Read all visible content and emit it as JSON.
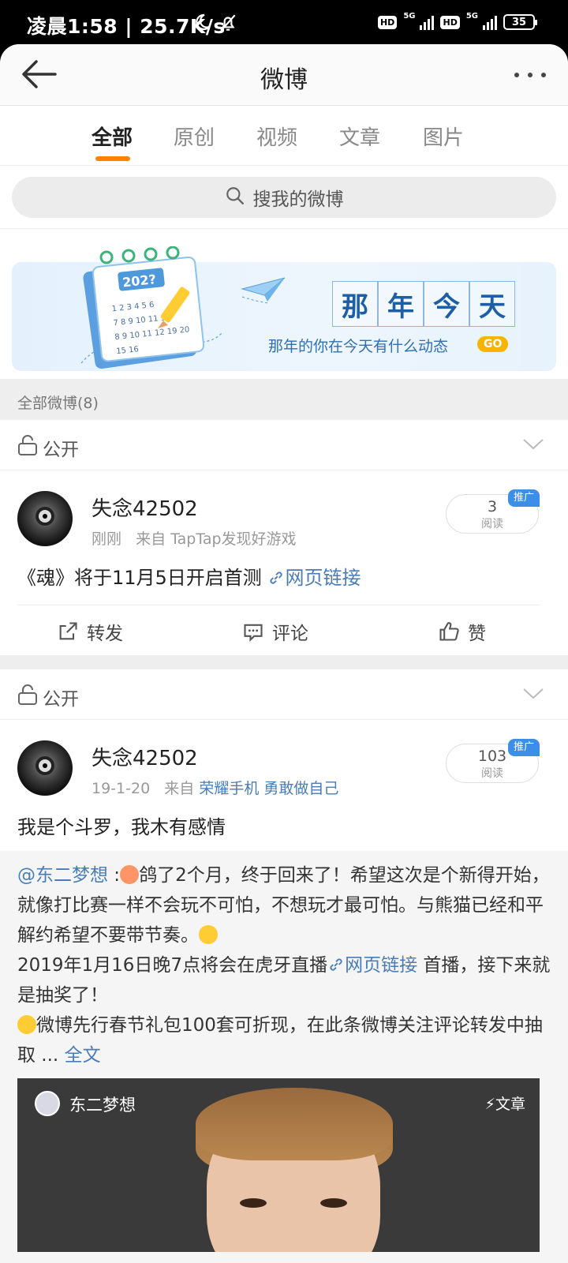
{
  "status_bar": {
    "time": "凌晨1:58 | 25.7K/s",
    "battery": "35",
    "network_badge": "HD",
    "network_type": "5G"
  },
  "header": {
    "title": "微博"
  },
  "tabs": [
    {
      "label": "全部",
      "active": true
    },
    {
      "label": "原创",
      "active": false
    },
    {
      "label": "视频",
      "active": false
    },
    {
      "label": "文章",
      "active": false
    },
    {
      "label": "图片",
      "active": false
    }
  ],
  "search": {
    "placeholder": "搜我的微博"
  },
  "banner": {
    "year": "202?",
    "title_chars": [
      "那",
      "年",
      "今",
      "天"
    ],
    "subtitle": "那年的你在今天有什么动态",
    "go": "GO"
  },
  "section": {
    "label": "全部微博(8)"
  },
  "posts": [
    {
      "privacy": "公开",
      "username": "失念42502",
      "time": "刚刚",
      "source_prefix": "来自",
      "source": "TapTap发现好游戏",
      "reads": "3",
      "reads_label": "阅读",
      "promo": "推广",
      "text": "《魂》将于11月5日开启首测",
      "link": "网页链接",
      "actions": {
        "repost": "转发",
        "comment": "评论",
        "like": "赞"
      }
    },
    {
      "privacy": "公开",
      "username": "失念42502",
      "time": "19-1-20",
      "source_prefix": "来自",
      "source": "荣耀手机 勇敢做自己",
      "reads": "103",
      "reads_label": "阅读",
      "promo": "推广",
      "text": "我是个斗罗，我木有感情",
      "repost": {
        "at_user": "@东二梦想",
        "line1": " :",
        "text1": "鸽了2个月，终于回来了！希望这次是个新得开始，就像打比赛一样不会玩不可怕，不想玩才最可怕。与熊猫已经和平解约希望不要带节奏。",
        "text2": "2019年1月16日晚7点将会在虎牙直播",
        "link": "网页链接",
        "text3": " 首播，接下来就是抽奖了！",
        "text4": "微博先行春节礼包100套可折现，在此条微博关注评论转发中抽取",
        "ellipsis": " ... ",
        "full": "全文"
      },
      "card": {
        "name": "东二梦想",
        "tag": "⚡文章"
      }
    }
  ]
}
